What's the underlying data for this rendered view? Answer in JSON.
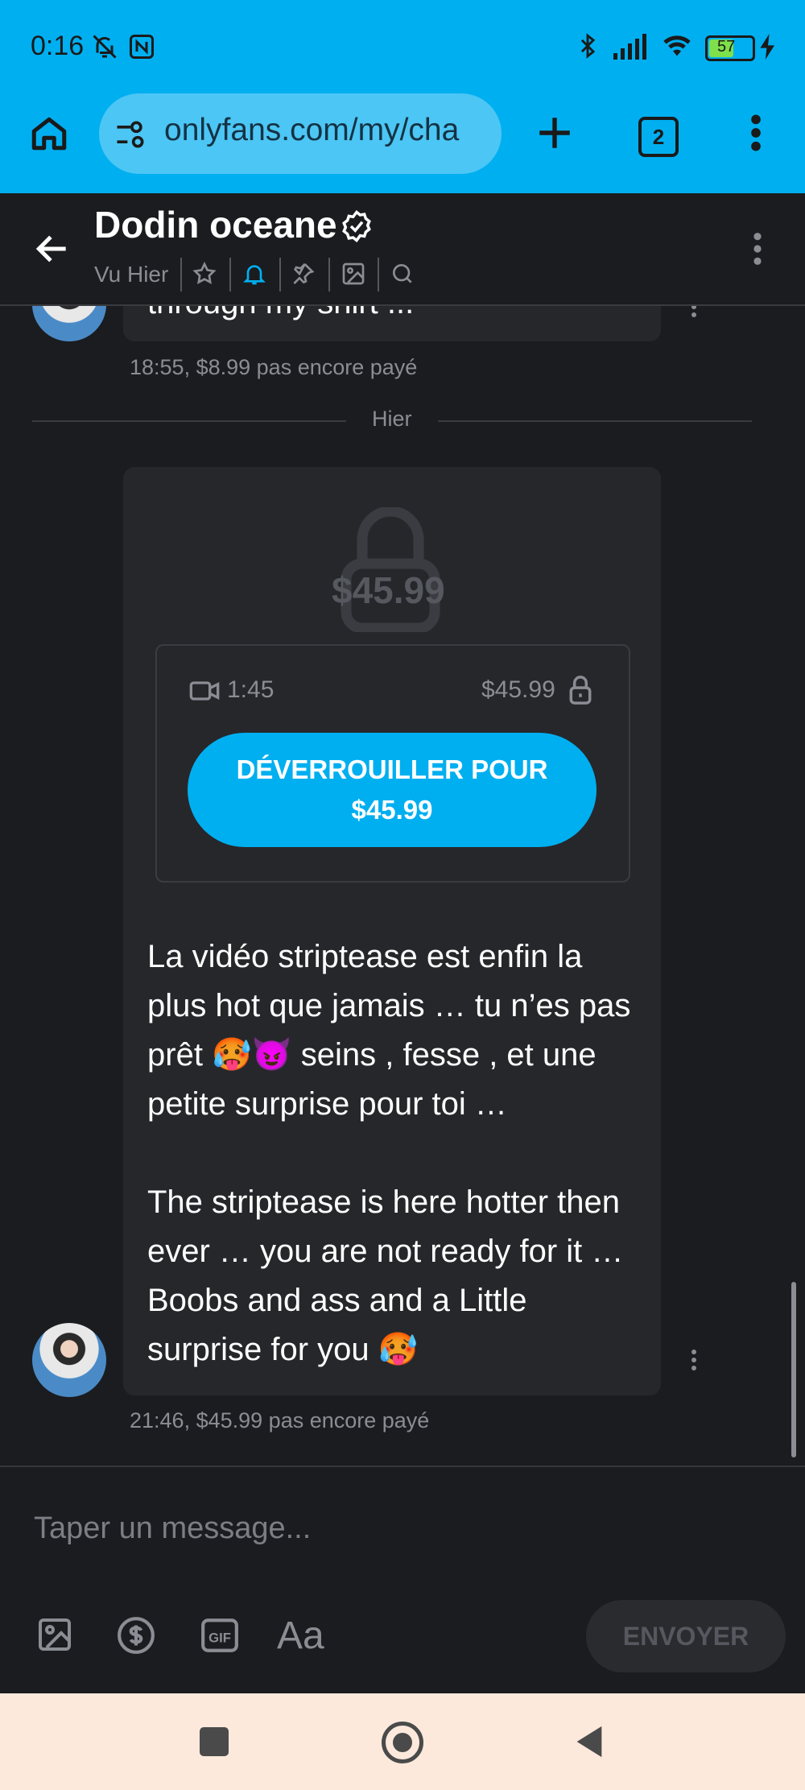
{
  "status_bar": {
    "time": "0:16",
    "battery": "57"
  },
  "browser": {
    "url": "onlyfans.com/my/cha",
    "tab_count": "2"
  },
  "chat": {
    "name": "Dodin oceane",
    "last_seen": "Vu Hier",
    "prev_message_partial": "through my shirt ...",
    "prev_meta_time": "18:55,",
    "prev_meta_price": "$8.99 pas encore payé",
    "date_divider": "Hier",
    "locked_price": "$45.99",
    "media_duration": "1:45",
    "media_price": "$45.99",
    "unlock_line1": "DÉVERROUILLER POUR",
    "unlock_line2": "$45.99",
    "message_text": "La vidéo striptease est enfin la plus hot que jamais … tu n’es pas prêt 🥵😈 seins , fesse , et une petite surprise pour toi …\n\nThe striptease is here hotter then ever … you are not ready for it … Boobs and ass and a Little surprise for you 🥵",
    "meta_time": "21:46,",
    "meta_price": "$45.99 pas encore payé"
  },
  "composer": {
    "placeholder": "Taper un message...",
    "send_label": "ENVOYER"
  },
  "colors": {
    "accent": "#00aff0",
    "background": "#1b1c1f",
    "bubble": "#26272b"
  }
}
